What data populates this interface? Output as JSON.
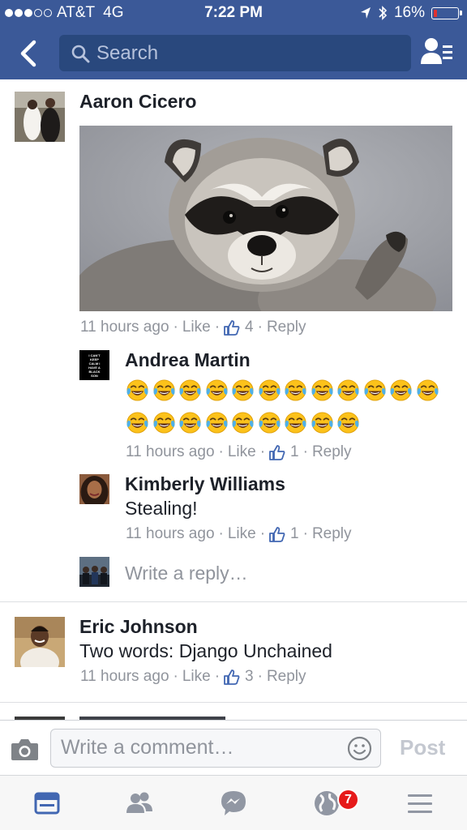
{
  "status_bar": {
    "carrier": "AT&T",
    "network": "4G",
    "time": "7:22 PM",
    "battery": "16%",
    "battery_level": 0.16
  },
  "header": {
    "search_placeholder": "Search"
  },
  "comments": [
    {
      "author": "Aaron Cicero",
      "text": "",
      "time": "11 hours ago",
      "like_label": "Like",
      "like_count": "4",
      "reply_label": "Reply",
      "replies": [
        {
          "author": "Andrea Martin",
          "text": "",
          "emoji_name": "face-with-tears-of-joy-icon",
          "emoji_counts": [
            12,
            9
          ],
          "time": "11 hours ago",
          "like_label": "Like",
          "like_count": "1",
          "reply_label": "Reply",
          "avatar_text": "I CAN'T KEEP CALM I HAVE A BLACK SON"
        },
        {
          "author": "Kimberly Williams",
          "text": "Stealing!",
          "time": "11 hours ago",
          "like_label": "Like",
          "like_count": "1",
          "reply_label": "Reply"
        }
      ],
      "write_reply_placeholder": "Write a reply…"
    },
    {
      "author": "Eric Johnson",
      "text": "Two words: Django Unchained",
      "time": "11 hours ago",
      "like_label": "Like",
      "like_count": "3",
      "reply_label": "Reply"
    }
  ],
  "composer": {
    "placeholder": "Write a comment…",
    "post_label": "Post"
  },
  "tabbar": {
    "notifications_badge": "7",
    "accent": "#4267b2"
  },
  "colors": {
    "header": "#3b5998",
    "search_field": "#29487d",
    "meta_text": "#90949c",
    "badge": "#e61a1a"
  }
}
